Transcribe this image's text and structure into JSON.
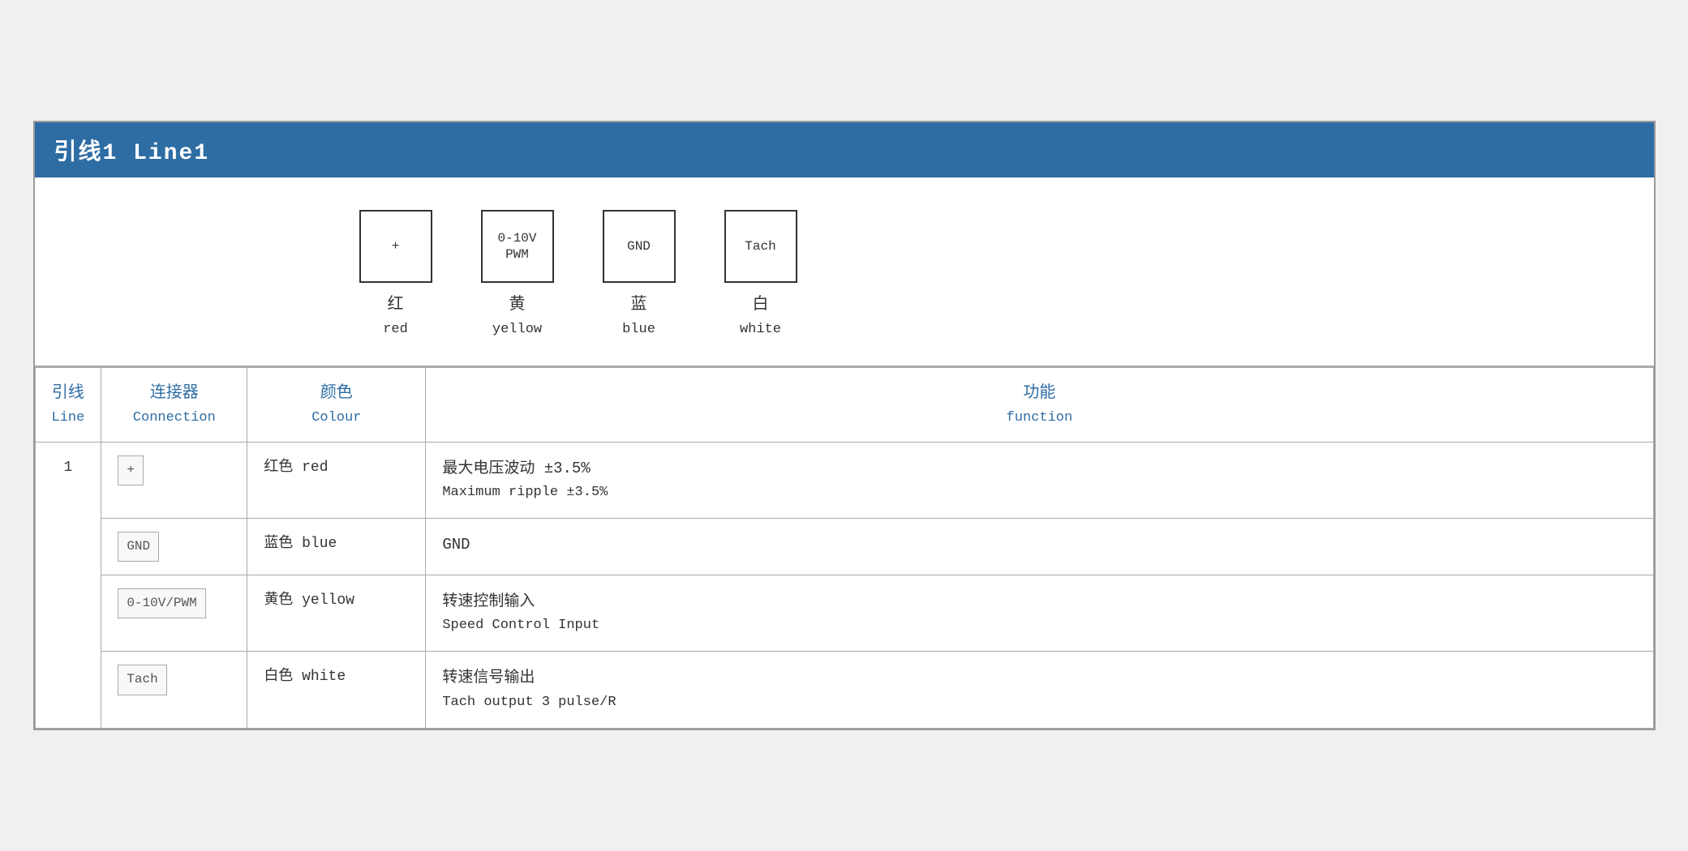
{
  "header": {
    "title": "引线1 Line1"
  },
  "diagram": {
    "pins": [
      {
        "id": "pin-plus",
        "box_label": "+",
        "chinese": "红",
        "english": "red"
      },
      {
        "id": "pin-pwm",
        "box_label": "0-10V\nPWM",
        "chinese": "黄",
        "english": "yellow"
      },
      {
        "id": "pin-gnd",
        "box_label": "GND",
        "chinese": "蓝",
        "english": "blue"
      },
      {
        "id": "pin-tach",
        "box_label": "Tach",
        "chinese": "白",
        "english": "white"
      }
    ]
  },
  "table": {
    "headers": {
      "line_zh": "引线",
      "line_en": "Line",
      "connection_zh": "连接器",
      "connection_en": "Connection",
      "colour_zh": "颜色",
      "colour_en": "Colour",
      "function_zh": "功能",
      "function_en": "function"
    },
    "rows": [
      {
        "line": "1",
        "connection": "+",
        "colour_zh": "红色 red",
        "function_zh": "最大电压波动 ±3.5%",
        "function_en": "Maximum ripple ±3.5%"
      },
      {
        "line": "",
        "connection": "GND",
        "colour_zh": "蓝色 blue",
        "function_zh": "GND",
        "function_en": ""
      },
      {
        "line": "",
        "connection": "0-10V/PWM",
        "colour_zh": "黄色 yellow",
        "function_zh": "转速控制输入",
        "function_en": "Speed Control Input"
      },
      {
        "line": "",
        "connection": "Tach",
        "colour_zh": "白色 white",
        "function_zh": "转速信号输出",
        "function_en": "Tach output 3 pulse/R"
      }
    ]
  }
}
